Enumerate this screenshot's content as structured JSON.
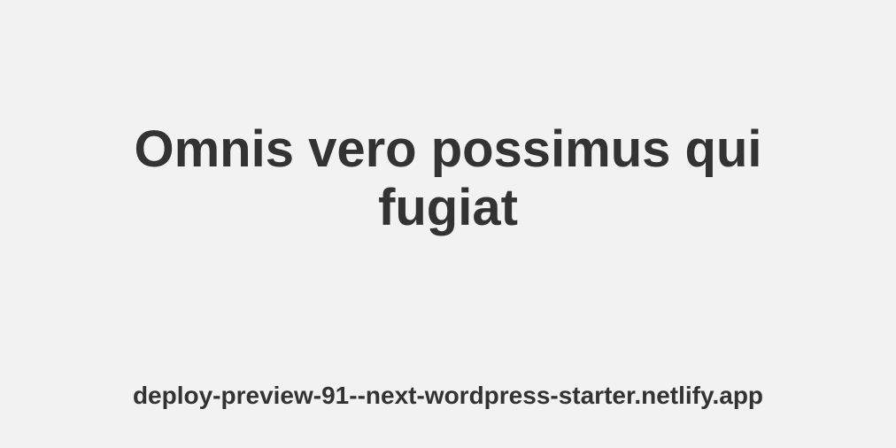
{
  "og_card": {
    "title": "Omnis vero possimus qui fugiat",
    "domain": "deploy-preview-91--next-wordpress-starter.netlify.app"
  }
}
